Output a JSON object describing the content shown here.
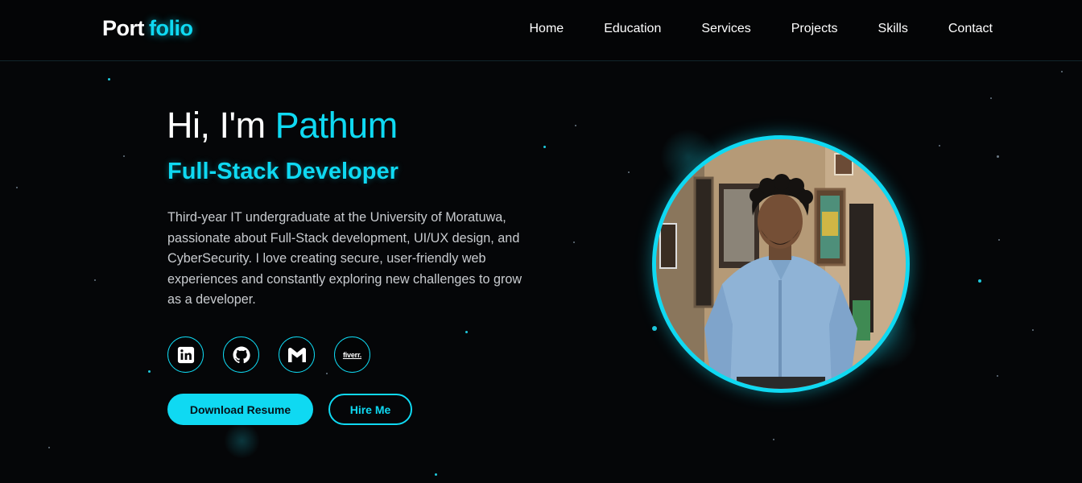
{
  "header": {
    "logo_part1": "Port",
    "logo_part2": "folio",
    "nav": [
      "Home",
      "Education",
      "Services",
      "Projects",
      "Skills",
      "Contact"
    ]
  },
  "hero": {
    "greeting": "Hi, I'm ",
    "name": "Pathum",
    "role": "Full-Stack Developer",
    "bio": "Third-year IT undergraduate at the University of Moratuwa, passionate about Full-Stack development, UI/UX design, and CyberSecurity. I love creating secure, user-friendly web experiences and constantly exploring new challenges to grow as a developer.",
    "socials": [
      {
        "icon": "linkedin-icon"
      },
      {
        "icon": "github-icon"
      },
      {
        "icon": "gmail-icon"
      },
      {
        "icon": "fiverr-icon",
        "text": "fiverr."
      }
    ],
    "download_label": "Download Resume",
    "hire_label": "Hire Me"
  },
  "colors": {
    "accent": "#0fd9f2",
    "background": "#050608"
  }
}
